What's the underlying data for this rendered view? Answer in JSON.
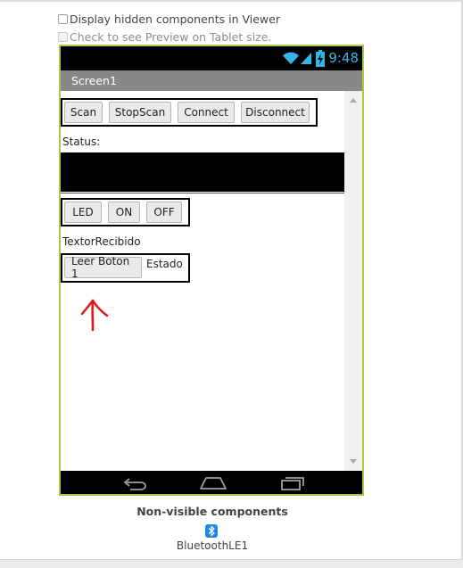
{
  "options": {
    "display_hidden": "Display hidden components in Viewer",
    "tablet_preview": "Check to see Preview on Tablet size."
  },
  "phone": {
    "time": "9:48",
    "screen_title": "Screen1"
  },
  "row1_buttons": [
    "Scan",
    "StopScan",
    "Connect",
    "Disconnect"
  ],
  "status_label": "Status:",
  "row2_buttons": [
    "LED",
    "ON",
    "OFF"
  ],
  "texto_recibido": "TextorRecibido",
  "leer_button": "Leer Boton 1",
  "estado_label": "Estado",
  "non_visible": {
    "title": "Non-visible components",
    "components": [
      "BluetoothLE1"
    ]
  },
  "colors": {
    "phone_border": "#a8c94a",
    "status_icons": "#33b5e5",
    "arrow": "#e0141b"
  }
}
